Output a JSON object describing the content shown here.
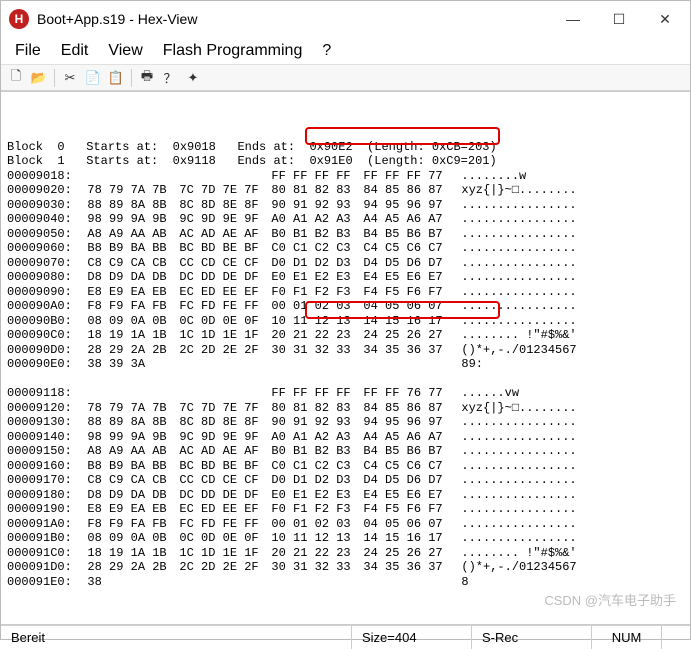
{
  "window": {
    "icon_letter": "H",
    "title": "Boot+App.s19 - Hex-View",
    "min": "—",
    "max": "☐",
    "close": "✕"
  },
  "menu": {
    "file": "File",
    "edit": "Edit",
    "view": "View",
    "flash": "Flash Programming",
    "help": "?"
  },
  "toolbar": {
    "new": "🗋",
    "open": "📂",
    "cut": "✂",
    "copy": "📄",
    "paste": "📋",
    "print": "🖶",
    "about": "？",
    "info": "✦"
  },
  "header_lines": [
    "Block  0   Starts at:  0x9018   Ends at:  0x90E2  (Length: 0xCB=203)",
    "Block  1   Starts at:  0x9118   Ends at:  0x91E0  (Length: 0xC9=201)"
  ],
  "hex_rows": [
    {
      "addr": "00009018:",
      "g": [
        "           ",
        "           ",
        "FF FF FF FF",
        "FF FF FF 77"
      ],
      "ascii": "........w"
    },
    {
      "addr": "00009020:",
      "g": [
        "78 79 7A 7B",
        "7C 7D 7E 7F",
        "80 81 82 83",
        "84 85 86 87"
      ],
      "ascii": "xyz{|}~□........"
    },
    {
      "addr": "00009030:",
      "g": [
        "88 89 8A 8B",
        "8C 8D 8E 8F",
        "90 91 92 93",
        "94 95 96 97"
      ],
      "ascii": "................"
    },
    {
      "addr": "00009040:",
      "g": [
        "98 99 9A 9B",
        "9C 9D 9E 9F",
        "A0 A1 A2 A3",
        "A4 A5 A6 A7"
      ],
      "ascii": "................"
    },
    {
      "addr": "00009050:",
      "g": [
        "A8 A9 AA AB",
        "AC AD AE AF",
        "B0 B1 B2 B3",
        "B4 B5 B6 B7"
      ],
      "ascii": "................"
    },
    {
      "addr": "00009060:",
      "g": [
        "B8 B9 BA BB",
        "BC BD BE BF",
        "C0 C1 C2 C3",
        "C4 C5 C6 C7"
      ],
      "ascii": "................"
    },
    {
      "addr": "00009070:",
      "g": [
        "C8 C9 CA CB",
        "CC CD CE CF",
        "D0 D1 D2 D3",
        "D4 D5 D6 D7"
      ],
      "ascii": "................"
    },
    {
      "addr": "00009080:",
      "g": [
        "D8 D9 DA DB",
        "DC DD DE DF",
        "E0 E1 E2 E3",
        "E4 E5 E6 E7"
      ],
      "ascii": "................"
    },
    {
      "addr": "00009090:",
      "g": [
        "E8 E9 EA EB",
        "EC ED EE EF",
        "F0 F1 F2 F3",
        "F4 F5 F6 F7"
      ],
      "ascii": "................"
    },
    {
      "addr": "000090A0:",
      "g": [
        "F8 F9 FA FB",
        "FC FD FE FF",
        "00 01 02 03",
        "04 05 06 07"
      ],
      "ascii": "................"
    },
    {
      "addr": "000090B0:",
      "g": [
        "08 09 0A 0B",
        "0C 0D 0E 0F",
        "10 11 12 13",
        "14 15 16 17"
      ],
      "ascii": "................"
    },
    {
      "addr": "000090C0:",
      "g": [
        "18 19 1A 1B",
        "1C 1D 1E 1F",
        "20 21 22 23",
        "24 25 26 27"
      ],
      "ascii": "........ !\"#$%&'"
    },
    {
      "addr": "000090D0:",
      "g": [
        "28 29 2A 2B",
        "2C 2D 2E 2F",
        "30 31 32 33",
        "34 35 36 37"
      ],
      "ascii": "()*+,-./01234567"
    },
    {
      "addr": "000090E0:",
      "g": [
        "38 39 3A   ",
        "           ",
        "           ",
        "           "
      ],
      "ascii": "89:"
    },
    {
      "addr": "",
      "g": [
        "",
        "",
        "",
        ""
      ],
      "ascii": ""
    },
    {
      "addr": "00009118:",
      "g": [
        "           ",
        "           ",
        "FF FF FF FF",
        "FF FF 76 77"
      ],
      "ascii": "......vw"
    },
    {
      "addr": "00009120:",
      "g": [
        "78 79 7A 7B",
        "7C 7D 7E 7F",
        "80 81 82 83",
        "84 85 86 87"
      ],
      "ascii": "xyz{|}~□........"
    },
    {
      "addr": "00009130:",
      "g": [
        "88 89 8A 8B",
        "8C 8D 8E 8F",
        "90 91 92 93",
        "94 95 96 97"
      ],
      "ascii": "................"
    },
    {
      "addr": "00009140:",
      "g": [
        "98 99 9A 9B",
        "9C 9D 9E 9F",
        "A0 A1 A2 A3",
        "A4 A5 A6 A7"
      ],
      "ascii": "................"
    },
    {
      "addr": "00009150:",
      "g": [
        "A8 A9 AA AB",
        "AC AD AE AF",
        "B0 B1 B2 B3",
        "B4 B5 B6 B7"
      ],
      "ascii": "................"
    },
    {
      "addr": "00009160:",
      "g": [
        "B8 B9 BA BB",
        "BC BD BE BF",
        "C0 C1 C2 C3",
        "C4 C5 C6 C7"
      ],
      "ascii": "................"
    },
    {
      "addr": "00009170:",
      "g": [
        "C8 C9 CA CB",
        "CC CD CE CF",
        "D0 D1 D2 D3",
        "D4 D5 D6 D7"
      ],
      "ascii": "................"
    },
    {
      "addr": "00009180:",
      "g": [
        "D8 D9 DA DB",
        "DC DD DE DF",
        "E0 E1 E2 E3",
        "E4 E5 E6 E7"
      ],
      "ascii": "................"
    },
    {
      "addr": "00009190:",
      "g": [
        "E8 E9 EA EB",
        "EC ED EE EF",
        "F0 F1 F2 F3",
        "F4 F5 F6 F7"
      ],
      "ascii": "................"
    },
    {
      "addr": "000091A0:",
      "g": [
        "F8 F9 FA FB",
        "FC FD FE FF",
        "00 01 02 03",
        "04 05 06 07"
      ],
      "ascii": "................"
    },
    {
      "addr": "000091B0:",
      "g": [
        "08 09 0A 0B",
        "0C 0D 0E 0F",
        "10 11 12 13",
        "14 15 16 17"
      ],
      "ascii": "................"
    },
    {
      "addr": "000091C0:",
      "g": [
        "18 19 1A 1B",
        "1C 1D 1E 1F",
        "20 21 22 23",
        "24 25 26 27"
      ],
      "ascii": "........ !\"#$%&'"
    },
    {
      "addr": "000091D0:",
      "g": [
        "28 29 2A 2B",
        "2C 2D 2E 2F",
        "30 31 32 33",
        "34 35 36 37"
      ],
      "ascii": "()*+,-./01234567"
    },
    {
      "addr": "000091E0:",
      "g": [
        "38         ",
        "           ",
        "           ",
        "           "
      ],
      "ascii": "8"
    }
  ],
  "statusbar": {
    "ready": "Bereit",
    "size": "Size=404",
    "format": "S-Rec",
    "num": "NUM"
  },
  "watermark": "CSDN @汽车电子助手"
}
